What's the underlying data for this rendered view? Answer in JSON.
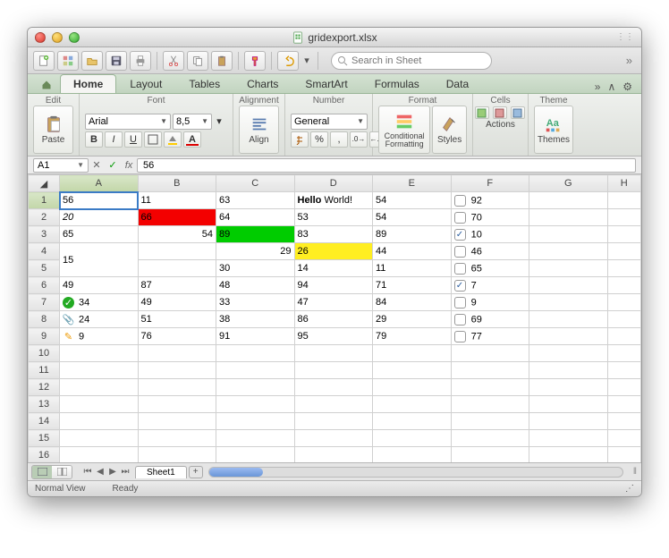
{
  "window": {
    "title": "gridexport.xlsx"
  },
  "toolbar": {
    "search_placeholder": "Search in Sheet"
  },
  "tabs": {
    "items": [
      "Home",
      "Layout",
      "Tables",
      "Charts",
      "SmartArt",
      "Formulas",
      "Data"
    ],
    "active": 0
  },
  "ribbon": {
    "groups": {
      "edit": "Edit",
      "font": "Font",
      "alignment": "Alignment",
      "number": "Number",
      "format": "Format",
      "cells": "Cells",
      "themes": "Theme"
    },
    "paste": "Paste",
    "font_name": "Arial",
    "font_size": "8,5",
    "align": "Align",
    "number_format": "General",
    "cond_fmt": "Conditional Formatting",
    "styles": "Styles",
    "actions": "Actions",
    "themes": "Themes"
  },
  "formula": {
    "cell_ref": "A1",
    "value": "56"
  },
  "grid": {
    "columns": [
      "A",
      "B",
      "C",
      "D",
      "E",
      "F",
      "G",
      "H"
    ],
    "rows": 16,
    "selected": {
      "row": 1,
      "col": "A"
    },
    "data": {
      "1": {
        "A": "56",
        "B": "11",
        "C": "63",
        "D_html": "<b>Hello</b> World!",
        "E": "54",
        "F_chk": false,
        "F": "92"
      },
      "2": {
        "A_italic": "20",
        "B_hl": "red",
        "B": "66",
        "C": "64",
        "D": "53",
        "E": "54",
        "F_chk": false,
        "F": "70"
      },
      "3": {
        "A": "65",
        "B_right": "54",
        "C_hl": "green",
        "C": "89",
        "D": "83",
        "E": "89",
        "F_chk": true,
        "F": "10"
      },
      "4": {
        "A_merge_45": "15",
        "C_right": "29",
        "D_hl": "yellow",
        "D": "26",
        "E": "44",
        "F_chk": false,
        "F": "46"
      },
      "5": {
        "C": "30",
        "D": "14",
        "E": "11",
        "F_chk": false,
        "F": "65"
      },
      "6": {
        "A": "49",
        "B": "87",
        "C": "48",
        "D": "94",
        "E": "71",
        "F_chk": true,
        "F": "7"
      },
      "7": {
        "A_icon": "check",
        "A": "34",
        "B": "49",
        "C": "33",
        "D": "47",
        "E": "84",
        "F_chk": false,
        "F": "9"
      },
      "8": {
        "A_icon": "clip",
        "A": "24",
        "B": "51",
        "C": "38",
        "D": "86",
        "E": "29",
        "F_chk": false,
        "F": "69"
      },
      "9": {
        "A_icon": "pencil",
        "A": "9",
        "B": "76",
        "C": "91",
        "D": "95",
        "E": "79",
        "F_chk": false,
        "F": "77"
      }
    }
  },
  "sheets": {
    "active": "Sheet1"
  },
  "status": {
    "view": "Normal View",
    "state": "Ready"
  }
}
